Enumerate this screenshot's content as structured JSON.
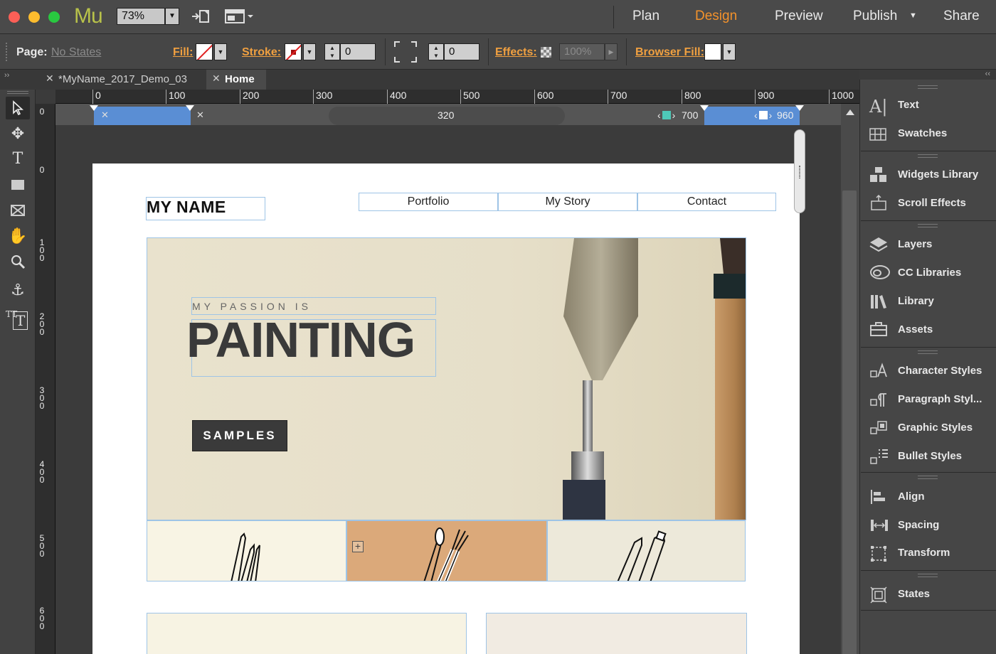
{
  "app": {
    "logo": "Mu",
    "zoom": "73%",
    "modes": [
      "Plan",
      "Design",
      "Preview",
      "Publish",
      "Share"
    ],
    "active_mode": "Design"
  },
  "controlbar": {
    "page_label": "Page:",
    "page_state": "No States",
    "fill_label": "Fill:",
    "stroke_label": "Stroke:",
    "stroke_width": "0",
    "corner_radius": "0",
    "effects_label": "Effects:",
    "opacity": "100%",
    "browser_fill_label": "Browser Fill:",
    "colors": {
      "accent": "#f0a040",
      "fill_swatch": "#ffffff"
    }
  },
  "tabs": [
    {
      "label": "*MyName_2017_Demo_03",
      "active": false
    },
    {
      "label": "Home",
      "active": true
    }
  ],
  "ruler": {
    "h_ticks": [
      "0",
      "100",
      "200",
      "300",
      "400",
      "500",
      "600",
      "700",
      "800",
      "900",
      "1000"
    ],
    "v_ticks": [
      "0",
      "0",
      "1\n0\n0",
      "2\n0\n0",
      "3\n0\n0",
      "4\n0\n0",
      "5\n0\n0",
      "6\n0\n0"
    ]
  },
  "breakpoints": {
    "center": "320",
    "left_bp": "700",
    "right_bp": "960",
    "colors": {
      "blue": "#5a8ed4",
      "teal": "#4ec9b8"
    }
  },
  "page": {
    "logo": "MY NAME",
    "nav": [
      "Portfolio",
      "My Story",
      "Contact"
    ],
    "hero_kicker": "MY PASSION IS",
    "hero_title": "PAINTING",
    "cta": "SAMPLES"
  },
  "panel": {
    "groups": [
      [
        {
          "label": "Text",
          "icon": "text-icon"
        },
        {
          "label": "Swatches",
          "icon": "swatches-icon"
        }
      ],
      [
        {
          "label": "Widgets Library",
          "icon": "widgets-icon"
        },
        {
          "label": "Scroll Effects",
          "icon": "scroll-effects-icon"
        }
      ],
      [
        {
          "label": "Layers",
          "icon": "layers-icon"
        },
        {
          "label": "CC Libraries",
          "icon": "cc-libraries-icon"
        },
        {
          "label": "Library",
          "icon": "library-icon"
        },
        {
          "label": "Assets",
          "icon": "assets-icon"
        }
      ],
      [
        {
          "label": "Character Styles",
          "icon": "character-styles-icon"
        },
        {
          "label": "Paragraph Styl...",
          "icon": "paragraph-styles-icon"
        },
        {
          "label": "Graphic Styles",
          "icon": "graphic-styles-icon"
        },
        {
          "label": "Bullet Styles",
          "icon": "bullet-styles-icon"
        }
      ],
      [
        {
          "label": "Align",
          "icon": "align-icon"
        },
        {
          "label": "Spacing",
          "icon": "spacing-icon"
        },
        {
          "label": "Transform",
          "icon": "transform-icon"
        }
      ],
      [
        {
          "label": "States",
          "icon": "states-icon"
        }
      ]
    ]
  }
}
